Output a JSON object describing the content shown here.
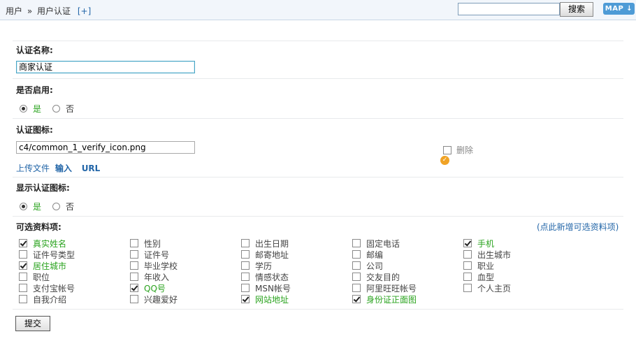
{
  "breadcrumb": {
    "home": "用户",
    "sep": "»",
    "current": "用户认证",
    "add": "[+]"
  },
  "header": {
    "search_value": "",
    "search_button": "搜索",
    "map_button": "MAP"
  },
  "form": {
    "name": {
      "label": "认证名称:",
      "value": "商家认证"
    },
    "enabled": {
      "label": "是否启用:",
      "yes": "是",
      "no": "否",
      "selected": "yes"
    },
    "icon": {
      "label": "认证图标:",
      "value": "c4/common_1_verify_icon.png",
      "upload": "上传文件",
      "input": "输入",
      "url": "URL",
      "delete": "删除"
    },
    "show_icon": {
      "label": "显示认证图标:",
      "yes": "是",
      "no": "否",
      "selected": "yes"
    },
    "fields": {
      "label": "可选资料项:",
      "add_link": "(点此新增可选资料项)",
      "items": [
        {
          "name": "真实姓名",
          "checked": true
        },
        {
          "name": "性别",
          "checked": false
        },
        {
          "name": "出生日期",
          "checked": false
        },
        {
          "name": "固定电话",
          "checked": false
        },
        {
          "name": "手机",
          "checked": true
        },
        {
          "name": "证件号类型",
          "checked": false
        },
        {
          "name": "证件号",
          "checked": false
        },
        {
          "name": "邮寄地址",
          "checked": false
        },
        {
          "name": "邮编",
          "checked": false
        },
        {
          "name": "出生城市",
          "checked": false
        },
        {
          "name": "居住城市",
          "checked": true
        },
        {
          "name": "毕业学校",
          "checked": false
        },
        {
          "name": "学历",
          "checked": false
        },
        {
          "name": "公司",
          "checked": false
        },
        {
          "name": "职业",
          "checked": false
        },
        {
          "name": "职位",
          "checked": false
        },
        {
          "name": "年收入",
          "checked": false
        },
        {
          "name": "情感状态",
          "checked": false
        },
        {
          "name": "交友目的",
          "checked": false
        },
        {
          "name": "血型",
          "checked": false
        },
        {
          "name": "支付宝帐号",
          "checked": false
        },
        {
          "name": "QQ号",
          "checked": true
        },
        {
          "name": "MSN帐号",
          "checked": false
        },
        {
          "name": "阿里旺旺帐号",
          "checked": false
        },
        {
          "name": "个人主页",
          "checked": false
        },
        {
          "name": "自我介绍",
          "checked": false
        },
        {
          "name": "兴趣爱好",
          "checked": false
        },
        {
          "name": "网站地址",
          "checked": true
        },
        {
          "name": "身份证正面图",
          "checked": true
        }
      ]
    },
    "submit": "提交"
  },
  "colors": {
    "accent": "#2366a8",
    "checked_text": "#2aa31e",
    "map_button": "#4e9bd6"
  }
}
